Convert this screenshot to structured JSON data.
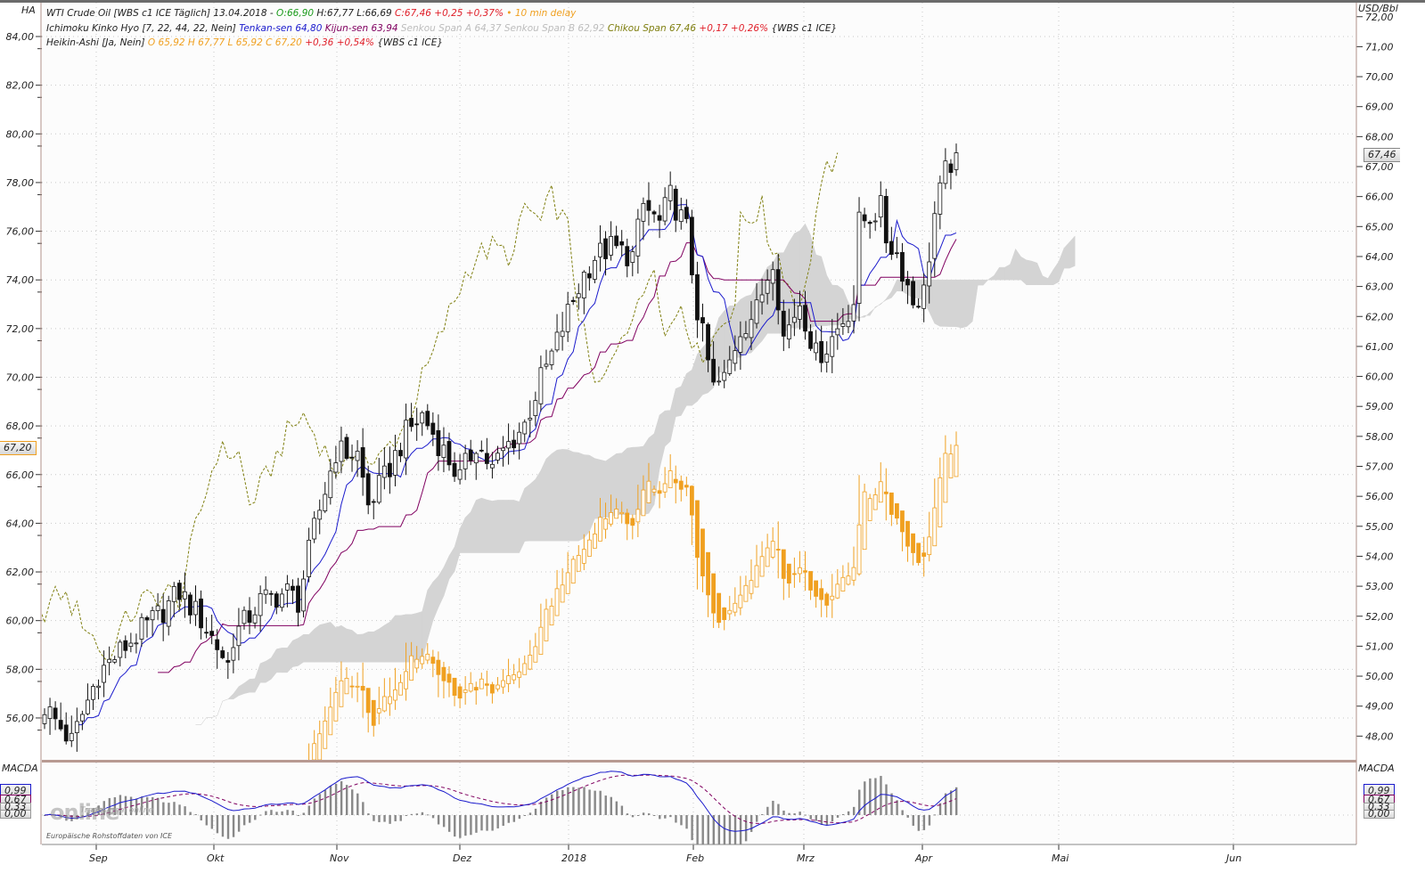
{
  "header": {
    "line1": {
      "name": "WTI Crude Oil [WBS c1 ICE Täglich] 13.04.2018 - ",
      "open": "O:66,90",
      "hl": " H:67,77 L:66,69 ",
      "close": "C:67,46 +0,25 +0,37%",
      "delay": " • 10 min delay"
    },
    "line2": {
      "name": "Ichimoku Kinko Hyo [7, 22, 44, 22, Nein] ",
      "tenkan": "Tenkan-sen 64,80 ",
      "kijun": "Kijun-sen 63,94 ",
      "spans": "Senkou Span A 64,37 Senkou Span B 62,92 ",
      "chikou": "Chikou Span 67,46 ",
      "change": "+0,17 +0,26% ",
      "source": "{WBS c1 ICE}"
    },
    "line3": {
      "name": "Heikin-Ashi [Ja, Nein] ",
      "ohlc": "O 65,92 H 67,77 L 65,92 C 67,20 ",
      "change": "+0,36 +0,54% ",
      "source": "{WBS c1 ICE}"
    }
  },
  "axes": {
    "left_unit": "HA",
    "right_unit": "USD/Bbl",
    "left_ticks": [
      "84,00",
      "82,00",
      "80,00",
      "78,00",
      "76,00",
      "74,00",
      "72,00",
      "70,00",
      "68,00",
      "66,00",
      "64,00",
      "62,00",
      "60,00",
      "58,00",
      "56,00"
    ],
    "right_ticks": [
      "72,00",
      "71,00",
      "70,00",
      "69,00",
      "68,00",
      "67,00",
      "66,00",
      "65,00",
      "64,00",
      "63,00",
      "62,00",
      "61,00",
      "60,00",
      "59,00",
      "58,00",
      "57,00",
      "56,00",
      "55,00",
      "54,00",
      "53,00",
      "52,00",
      "51,00",
      "50,00",
      "49,00",
      "48,00"
    ],
    "months": [
      "Sep",
      "Okt",
      "Nov",
      "Dez",
      "2018",
      "Feb",
      "Mrz",
      "Apr",
      "Mai",
      "Jun"
    ],
    "left_last": "67,20",
    "right_last": "67,46",
    "macd_label": "MACDA",
    "macd_markers": [
      "0,99",
      "0,67",
      "0,33",
      "0,00"
    ]
  },
  "watermark": {
    "brand": "Tradesignal online",
    "caption": "Europäische Rohstoffdaten von ICE"
  },
  "colors": {
    "tenkan": "#1a1acc",
    "kijun": "#800060",
    "chikou": "#7f7f10",
    "cloud": "#d4d4d4",
    "heikin_ashi": "#f0a020",
    "candle_down": "#111111",
    "candle_up": "#ffffff",
    "macd": "#1a1acc",
    "signal": "#800060",
    "histogram": "#888888"
  },
  "chart_data": {
    "type": "candlestick",
    "instrument": "WTI Crude Oil [WBS c1 ICE Täglich]",
    "last_bar": {
      "date": "2018-04-13",
      "open": 66.9,
      "high": 67.77,
      "low": 66.69,
      "close": 67.46
    },
    "heikin_ashi_last": {
      "open": 65.92,
      "high": 67.77,
      "low": 65.92,
      "close": 67.2
    },
    "ichimoku": {
      "params": [
        7,
        22,
        44,
        22
      ],
      "tenkan": 64.8,
      "kijun": 63.94,
      "span_a": 64.37,
      "span_b": 62.92,
      "chikou": 67.46
    },
    "right_axis_range": [
      47.5,
      72
    ],
    "left_axis_range": [
      55,
      84
    ],
    "close_keypoints": [
      {
        "date": "2017-08-21",
        "close": 49.0
      },
      {
        "date": "2017-08-28",
        "close": 47.8
      },
      {
        "date": "2017-09-04",
        "close": 50.1
      },
      {
        "date": "2017-09-11",
        "close": 51.0
      },
      {
        "date": "2017-09-20",
        "close": 52.2
      },
      {
        "date": "2017-09-25",
        "close": 52.8
      },
      {
        "date": "2017-09-29",
        "close": 51.9
      },
      {
        "date": "2017-10-06",
        "close": 50.4
      },
      {
        "date": "2017-10-09",
        "close": 51.3
      },
      {
        "date": "2017-10-16",
        "close": 52.5
      },
      {
        "date": "2017-10-23",
        "close": 52.8
      },
      {
        "date": "2017-10-25",
        "close": 52.5
      },
      {
        "date": "2017-10-30",
        "close": 54.9
      },
      {
        "date": "2017-11-03",
        "close": 57.5
      },
      {
        "date": "2017-11-09",
        "close": 57.4
      },
      {
        "date": "2017-11-13",
        "close": 55.7
      },
      {
        "date": "2017-11-16",
        "close": 56.6
      },
      {
        "date": "2017-11-22",
        "close": 58.1
      },
      {
        "date": "2017-11-27",
        "close": 58.7
      },
      {
        "date": "2017-11-30",
        "close": 57.8
      },
      {
        "date": "2017-12-06",
        "close": 56.6
      },
      {
        "date": "2017-12-11",
        "close": 57.8
      },
      {
        "date": "2017-12-14",
        "close": 56.9
      },
      {
        "date": "2017-12-18",
        "close": 57.5
      },
      {
        "date": "2017-12-22",
        "close": 58.4
      },
      {
        "date": "2017-12-27",
        "close": 59.9
      },
      {
        "date": "2017-12-29",
        "close": 60.7
      },
      {
        "date": "2018-01-03",
        "close": 62.1
      },
      {
        "date": "2018-01-08",
        "close": 63.4
      },
      {
        "date": "2018-01-10",
        "close": 64.0
      },
      {
        "date": "2018-01-15",
        "close": 64.3
      },
      {
        "date": "2018-01-19",
        "close": 64.0
      },
      {
        "date": "2018-01-23",
        "close": 65.7
      },
      {
        "date": "2018-01-26",
        "close": 65.1
      },
      {
        "date": "2018-01-30",
        "close": 66.0
      },
      {
        "date": "2018-02-02",
        "close": 64.9
      },
      {
        "date": "2018-02-06",
        "close": 62.2
      },
      {
        "date": "2018-02-09",
        "close": 59.6
      },
      {
        "date": "2018-02-13",
        "close": 59.9
      },
      {
        "date": "2018-02-16",
        "close": 61.6
      },
      {
        "date": "2018-02-21",
        "close": 62.2
      },
      {
        "date": "2018-02-26",
        "close": 64.0
      },
      {
        "date": "2018-02-28",
        "close": 61.3
      },
      {
        "date": "2018-03-05",
        "close": 62.5
      },
      {
        "date": "2018-03-08",
        "close": 60.7
      },
      {
        "date": "2018-03-12",
        "close": 61.0
      },
      {
        "date": "2018-03-19",
        "close": 62.5
      },
      {
        "date": "2018-03-20",
        "close": 65.1
      },
      {
        "date": "2018-03-26",
        "close": 65.6
      },
      {
        "date": "2018-03-27",
        "close": 64.6
      },
      {
        "date": "2018-03-29",
        "close": 64.1
      },
      {
        "date": "2018-04-03",
        "close": 62.5
      },
      {
        "date": "2018-04-05",
        "close": 62.8
      },
      {
        "date": "2018-04-09",
        "close": 65.4
      },
      {
        "date": "2018-04-11",
        "close": 66.8
      },
      {
        "date": "2018-04-13",
        "close": 67.46
      }
    ]
  }
}
